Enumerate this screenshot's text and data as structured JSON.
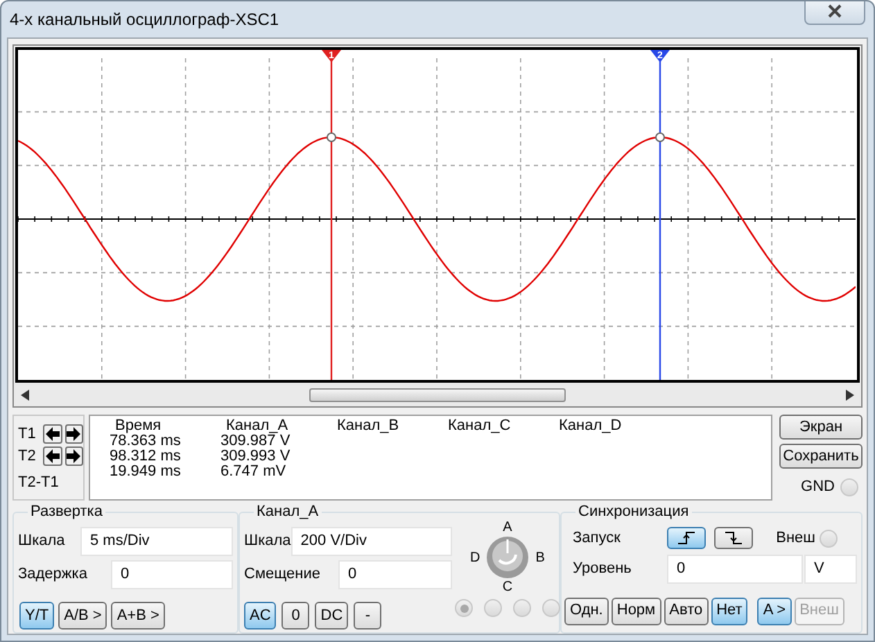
{
  "window": {
    "title": "4-х канальный осциллограф-XSC1"
  },
  "screen": {
    "cursors": [
      {
        "label": "1",
        "color": "#e02020"
      },
      {
        "label": "2",
        "color": "#2848e8"
      }
    ]
  },
  "readout": {
    "rows": [
      {
        "label": "T1",
        "kind": "cursor"
      },
      {
        "label": "T2",
        "kind": "cursor"
      },
      {
        "label": "T2-T1",
        "kind": "diff"
      }
    ],
    "columns": [
      "Время",
      "Канал_A",
      "Канал_B",
      "Канал_C",
      "Канал_D"
    ],
    "values": [
      [
        "78.363 ms",
        "309.987 V"
      ],
      [
        "98.312 ms",
        "309.993 V"
      ],
      [
        "19.949 ms",
        "6.747 mV"
      ]
    ]
  },
  "side": {
    "buttons": [
      "Экран",
      "Сохранить"
    ],
    "gnd": {
      "label": "GND",
      "selected": false
    }
  },
  "timebase": {
    "title": "Развертка",
    "fields": [
      {
        "label": "Шкала",
        "value": "5 ms/Div"
      },
      {
        "label": "Задержка",
        "value": "0"
      }
    ],
    "modes": [
      {
        "label": "Y/T",
        "selected": true
      },
      {
        "label": "A/B >",
        "selected": false
      },
      {
        "label": "A+B >",
        "selected": false
      }
    ]
  },
  "channel": {
    "title": "Канал_A",
    "fields": [
      {
        "label": "Шкала",
        "value": "200  V/Div"
      },
      {
        "label": "Смещение",
        "value": "0"
      }
    ],
    "coupling": [
      {
        "label": "AC",
        "selected": true
      },
      {
        "label": "0",
        "selected": false
      },
      {
        "label": "DC",
        "selected": false
      },
      {
        "label": "-",
        "selected": false
      }
    ],
    "knob_labels": {
      "top": "A",
      "right": "B",
      "bottom": "C",
      "left": "D"
    },
    "radios": [
      {
        "selected": true
      },
      {
        "selected": false
      },
      {
        "selected": false
      },
      {
        "selected": false
      }
    ]
  },
  "trigger": {
    "title": "Синхронизация",
    "edge_label": "Запуск",
    "edges": [
      {
        "kind": "rising",
        "selected": true
      },
      {
        "kind": "falling",
        "selected": false
      }
    ],
    "ext": {
      "label": "Внеш",
      "selected": false
    },
    "level": {
      "label": "Уровень",
      "value": "0",
      "unit": "V"
    },
    "modes": [
      {
        "label": "Одн.",
        "selected": false
      },
      {
        "label": "Норм",
        "selected": false
      },
      {
        "label": "Авто",
        "selected": false
      },
      {
        "label": "Нет",
        "selected": true
      }
    ],
    "sources": [
      {
        "label": "A >",
        "selected": true,
        "disabled": false
      },
      {
        "label": "Внеш",
        "selected": false,
        "disabled": true
      }
    ]
  }
}
